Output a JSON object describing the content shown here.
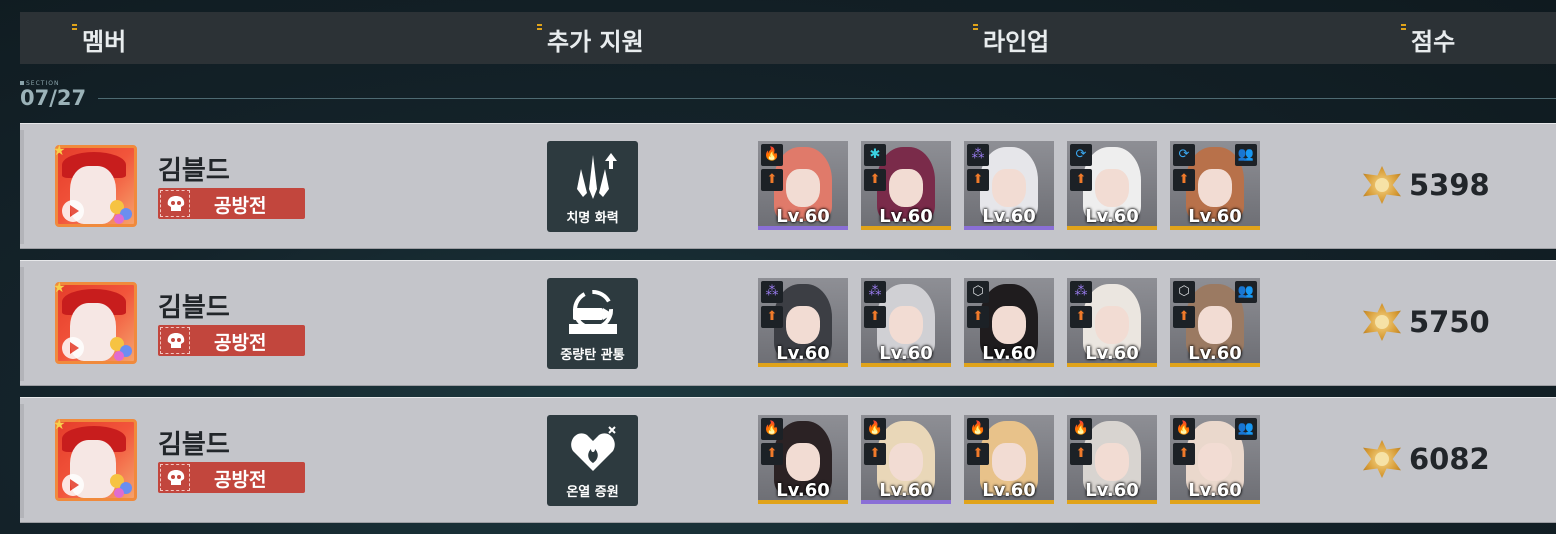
{
  "header": {
    "col_member": "멤버",
    "col_support": "추가 지원",
    "col_lineup": "라인업",
    "col_score": "점수"
  },
  "section": {
    "label": "SECTION",
    "date": "07/27"
  },
  "rows": [
    {
      "member": {
        "name": "김블드",
        "badge": "공방전"
      },
      "support": {
        "label": "치명 화력",
        "icon": "critical-firepower-icon"
      },
      "lineup": [
        {
          "level": "Lv.60",
          "element": "fire",
          "rarity_color": "#8a6fd6"
        },
        {
          "level": "Lv.60",
          "element": "ice",
          "rarity_color": "#e0a31a"
        },
        {
          "level": "Lv.60",
          "element": "nexus",
          "rarity_color": "#8a6fd6"
        },
        {
          "level": "Lv.60",
          "element": "hydro",
          "rarity_color": "#e0a31a"
        },
        {
          "level": "Lv.60",
          "element": "hydro",
          "rarity_color": "#e0a31a",
          "support_unit": true
        }
      ],
      "score": "5398"
    },
    {
      "member": {
        "name": "김블드",
        "badge": "공방전"
      },
      "support": {
        "label": "중량탄 관통",
        "icon": "heavy-round-penetration-icon"
      },
      "lineup": [
        {
          "level": "Lv.60",
          "element": "nexus",
          "rarity_color": "#e0a31a"
        },
        {
          "level": "Lv.60",
          "element": "nexus",
          "rarity_color": "#e0a31a"
        },
        {
          "level": "Lv.60",
          "element": "physical",
          "rarity_color": "#e0a31a"
        },
        {
          "level": "Lv.60",
          "element": "nexus",
          "rarity_color": "#e0a31a"
        },
        {
          "level": "Lv.60",
          "element": "physical",
          "rarity_color": "#e0a31a",
          "support_unit": true
        }
      ],
      "score": "5750"
    },
    {
      "member": {
        "name": "김블드",
        "badge": "공방전"
      },
      "support": {
        "label": "온열 증원",
        "icon": "thermal-reinforcement-icon"
      },
      "lineup": [
        {
          "level": "Lv.60",
          "element": "fire",
          "rarity_color": "#e0a31a"
        },
        {
          "level": "Lv.60",
          "element": "fire",
          "rarity_color": "#8a6fd6"
        },
        {
          "level": "Lv.60",
          "element": "fire",
          "rarity_color": "#e0a31a"
        },
        {
          "level": "Lv.60",
          "element": "fire",
          "rarity_color": "#e0a31a"
        },
        {
          "level": "Lv.60",
          "element": "fire",
          "rarity_color": "#e0a31a",
          "support_unit": true
        }
      ],
      "score": "6082"
    }
  ],
  "colors": {
    "accent_gold": "#e0a31a",
    "badge_red": "#c2463d",
    "panel_dark": "#2d3a3f",
    "row_bg": "#c4c5ca"
  }
}
